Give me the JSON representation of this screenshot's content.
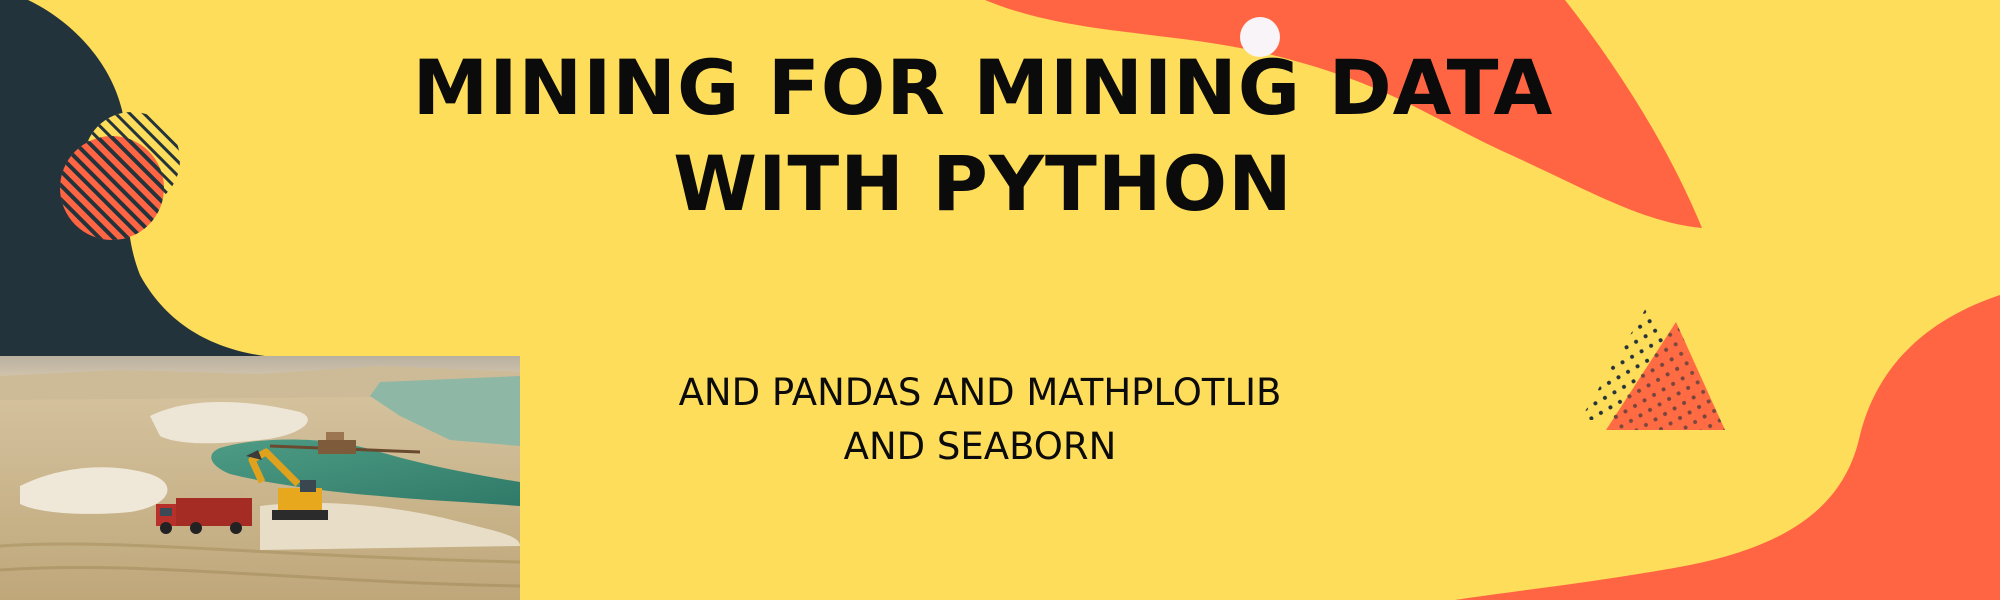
{
  "banner": {
    "title_line1": "MINING FOR MINING DATA",
    "title_line2": "WITH PYTHON",
    "subtitle_line1": "AND PANDAS AND MATHPLOTLIB",
    "subtitle_line2": "AND SEABORN"
  },
  "colors": {
    "background": "#FEDD5A",
    "accent_orange": "#FF6542",
    "dark_navy": "#23333B",
    "text": "#0B0B0B",
    "white_dot": "#F8F4F8"
  },
  "image": {
    "subject": "open-pit sand quarry with excavator loading a red dump truck beside a green pond"
  },
  "decorations": [
    "striped-circle-icon",
    "dotted-triangle-icon",
    "white-dot-icon"
  ]
}
